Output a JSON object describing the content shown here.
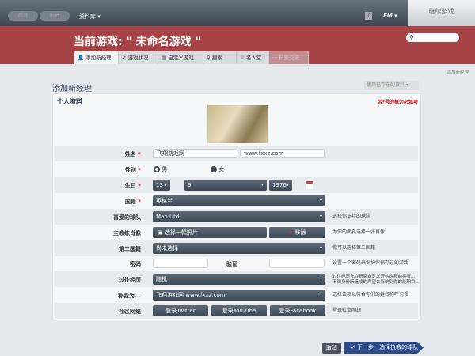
{
  "topbar": {
    "back": "后退",
    "forward": "前进",
    "library": "资料库",
    "help": "?",
    "fm": "FM",
    "continue": "继续游戏"
  },
  "banner": {
    "title": "当前游戏: \" 未命名游戏 \"",
    "search_placeholder": ""
  },
  "tabs": [
    {
      "label": "添加新经理",
      "icon": "user-icon"
    },
    {
      "label": "游戏状况",
      "icon": "check-icon"
    },
    {
      "label": "自定义游戏",
      "icon": "document-icon"
    },
    {
      "label": "搜索",
      "icon": "search-icon"
    },
    {
      "label": "名人堂",
      "icon": "trophy-icon"
    },
    {
      "label": "玩家交流",
      "icon": "chat-icon"
    }
  ],
  "breadcrumb": "添加新经理",
  "page": {
    "heading": "添加新经理",
    "use_existing": "使用已存在的资料",
    "section": "个人资料",
    "required_note": "带*号的框为必填项"
  },
  "form": {
    "name": {
      "label": "姓名",
      "first": "飞翔游戏网",
      "last": "www.fxxz.com"
    },
    "gender": {
      "label": "性别",
      "male": "男",
      "female": "女",
      "selected": "女"
    },
    "dob": {
      "label": "生日",
      "day": "13",
      "month": "9",
      "year": "1976"
    },
    "nationality": {
      "label": "国籍",
      "value": "英格兰"
    },
    "fav_team": {
      "label": "喜爱的球队",
      "value": "Man Utd",
      "help": "选择你支持的球队"
    },
    "portrait": {
      "label": "主教练肖像",
      "choose": "选择一幅照片",
      "remove": "移除",
      "help": "为你的面孔选择一张肖像"
    },
    "second_nat": {
      "label": "第二国籍",
      "value": "尚未选择",
      "help": "你可以选择第二国籍"
    },
    "password": {
      "label": "密码",
      "verify": "验证",
      "help": "设置一个密码来保护你保存过的游戏"
    },
    "history": {
      "label": "过往经历",
      "value": "随机",
      "help1": "过往经历允许玩家自定义开始执教前拥有...",
      "help2": "不同身份所造成的声望会影响到你的能职目..."
    },
    "callme": {
      "label": "称我为...",
      "value": "飞翔游戏网 www.fxxz.com",
      "help": "选择该项以符合你们的姓名称呼习惯"
    },
    "social": {
      "label": "社区网络",
      "twitter": "登录Twitter",
      "youtube": "登录YouTube",
      "facebook": "登录Facebook",
      "help": "登录社交网络"
    }
  },
  "footer": {
    "cancel": "取消",
    "next": "下一步 - 选择执教的球队"
  },
  "colors": {
    "banner": "#a64346",
    "button": "#3d4854",
    "next": "#2a4a8a"
  }
}
